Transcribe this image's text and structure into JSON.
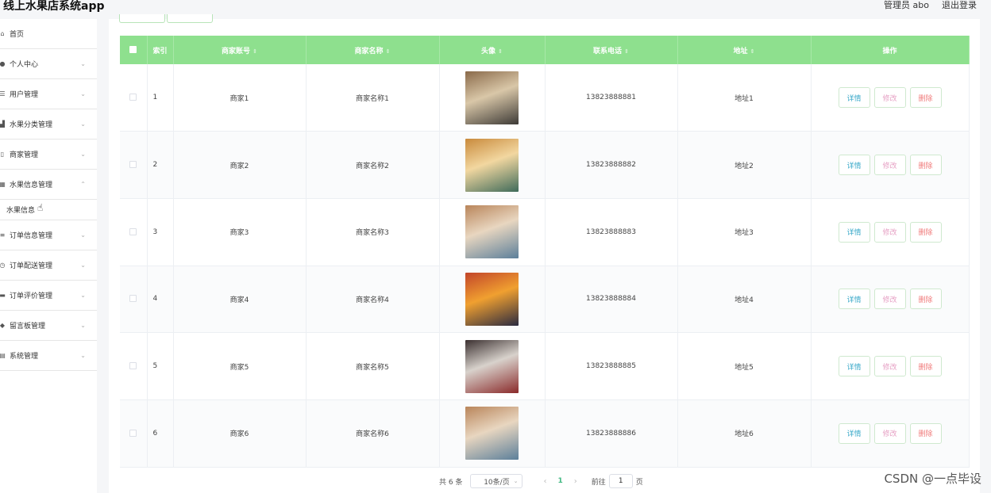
{
  "header": {
    "title": "线上水果店系统app",
    "user_label": "管理员 abo",
    "logout_label": "退出登录"
  },
  "sidebar": {
    "items": [
      {
        "label": "首页",
        "icon": "home-icon",
        "glyph": "⌂",
        "arrow": ""
      },
      {
        "label": "个人中心",
        "icon": "user-icon",
        "glyph": "●",
        "arrow": "⌄"
      },
      {
        "label": "用户管理",
        "icon": "filter-icon",
        "glyph": "☰",
        "arrow": "⌄"
      },
      {
        "label": "水果分类管理",
        "icon": "chart-icon",
        "glyph": "▟",
        "arrow": "⌄"
      },
      {
        "label": "商家管理",
        "icon": "store-icon",
        "glyph": "▯",
        "arrow": "⌄"
      },
      {
        "label": "水果信息管理",
        "icon": "grid-icon",
        "glyph": "▦",
        "arrow": "⌃"
      }
    ],
    "submenu": {
      "label": "水果信息"
    },
    "items_after": [
      {
        "label": "订单信息管理",
        "icon": "list-icon",
        "glyph": "≡",
        "arrow": "⌄"
      },
      {
        "label": "订单配送管理",
        "icon": "clock-icon",
        "glyph": "◷",
        "arrow": "⌄"
      },
      {
        "label": "订单评价管理",
        "icon": "comment-icon",
        "glyph": "▬",
        "arrow": "⌄"
      },
      {
        "label": "留言板管理",
        "icon": "message-icon",
        "glyph": "◆",
        "arrow": "⌄"
      },
      {
        "label": "系统管理",
        "icon": "settings-icon",
        "glyph": "▤",
        "arrow": "⌄"
      }
    ]
  },
  "table": {
    "columns": [
      "索引",
      "商家账号",
      "商家名称",
      "头像",
      "联系电话",
      "地址",
      "操作"
    ],
    "sortable_glyph": "⇕",
    "rows": [
      {
        "index": "1",
        "account": "商家1",
        "name": "商家名称1",
        "phone": "13823888881",
        "address": "地址1"
      },
      {
        "index": "2",
        "account": "商家2",
        "name": "商家名称2",
        "phone": "13823888882",
        "address": "地址2"
      },
      {
        "index": "3",
        "account": "商家3",
        "name": "商家名称3",
        "phone": "13823888883",
        "address": "地址3"
      },
      {
        "index": "4",
        "account": "商家4",
        "name": "商家名称4",
        "phone": "13823888884",
        "address": "地址4"
      },
      {
        "index": "5",
        "account": "商家5",
        "name": "商家名称5",
        "phone": "13823888885",
        "address": "地址5"
      },
      {
        "index": "6",
        "account": "商家6",
        "name": "商家名称6",
        "phone": "13823888886",
        "address": "地址6"
      }
    ],
    "actions": {
      "detail": "详情",
      "edit": "修改",
      "delete": "删除"
    }
  },
  "thumb_colors": [
    [
      "#8a6a4a",
      "#d9c7a8",
      "#3d3a36"
    ],
    [
      "#c98a3c",
      "#f2d7a0",
      "#3f6b5a"
    ],
    [
      "#b9855a",
      "#e8d6c0",
      "#5c7f9a"
    ],
    [
      "#c2452a",
      "#f0a030",
      "#2a2a40"
    ],
    [
      "#3b3030",
      "#d8d2cc",
      "#8a2a2a"
    ],
    [
      "#b9855a",
      "#e8d6c0",
      "#5c7f9a"
    ]
  ],
  "pagination": {
    "total": "共 6 条",
    "page_size": "10条/页",
    "prev": "‹",
    "current": "1",
    "next": "›",
    "goto_label": "前往",
    "goto_value": "1",
    "page_unit": "页"
  },
  "watermark": "CSDN @一点毕设"
}
